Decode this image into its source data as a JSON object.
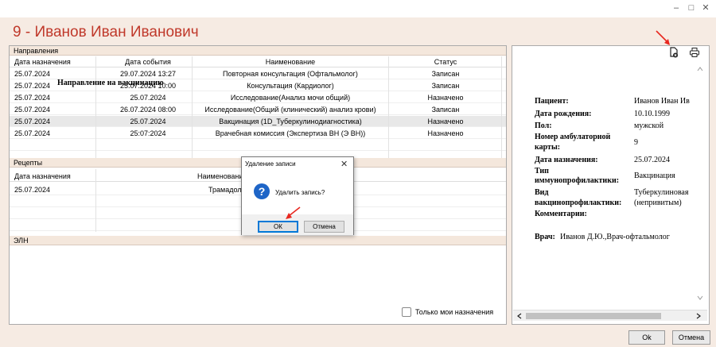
{
  "window": {
    "title": "9 - Иванов Иван Иванович"
  },
  "directions": {
    "section_label": "Направления",
    "columns": [
      "Дата назначения",
      "Дата события",
      "Наименование",
      "Статус"
    ],
    "rows": [
      [
        "25.07.2024",
        "29.07.2024 13:27",
        "Повторная консультация (Офтальмолог)",
        "Записан"
      ],
      [
        "25.07.2024",
        "25.07.2024 10:00",
        "Консультация (Кардиолог)",
        "Записан"
      ],
      [
        "25.07.2024",
        "25.07.2024",
        "Исследование(Анализ мочи общий)",
        "Назначено"
      ],
      [
        "25.07.2024",
        "26.07.2024 08:00",
        "Исследование(Общий (клинический) анализ крови)",
        "Записан"
      ],
      [
        "25.07.2024",
        "25.07.2024",
        "Вакцинация (1D_Туберкулинодиагностика)",
        "Назначено"
      ],
      [
        "25.07.2024",
        "25:07:2024",
        "Врачебная комиссия (Экспертиза ВН (Э ВН))",
        "Назначено"
      ]
    ]
  },
  "prescriptions": {
    "section_label": "Рецепты",
    "columns": [
      "Дата назначения",
      "Наименовани"
    ],
    "rows": [
      [
        "25.07.2024",
        "Трамадол"
      ]
    ]
  },
  "eln": {
    "section_label": "ЭЛН"
  },
  "only_mine": {
    "label": "Только мои назначения",
    "checked": false
  },
  "document": {
    "title": "Направление на вакцинацию",
    "patient_label": "Пациент:",
    "patient_value": "Иванов Иван Ив",
    "dob_label": "Дата рождения:",
    "dob_value": "10.10.1999",
    "sex_label": "Пол:",
    "sex_value": "мужской",
    "card_label_1": "Номер амбулаторной",
    "card_label_2": "карты:",
    "card_value": "9",
    "date_label": "Дата назначения:",
    "date_value": "25.07.2024",
    "type_label_1": "Тип",
    "type_label_2": "иммунопрофилактики:",
    "type_value": "Вакцинация",
    "kind_label_1": "Вид",
    "kind_label_2": "вакцинопрофилактики:",
    "kind_value_1": "Туберкулиновая",
    "kind_value_2": "(непривитым)",
    "comments_label": "Комментарии:",
    "doctor_label": "Врач:",
    "doctor_value": "Иванов Д.Ю.,Врач-офтальмолог"
  },
  "footer": {
    "ok_label": "Ok",
    "cancel_label": "Отмена"
  },
  "dialog": {
    "title": "Удаление записи",
    "message": "Удалить запись?",
    "ok_label": "ОК",
    "cancel_label": "Отмена"
  },
  "colors": {
    "title_red": "#c0392b",
    "annotation_arrow": "#e8271f",
    "dialog_icon": "#1e65c7"
  }
}
